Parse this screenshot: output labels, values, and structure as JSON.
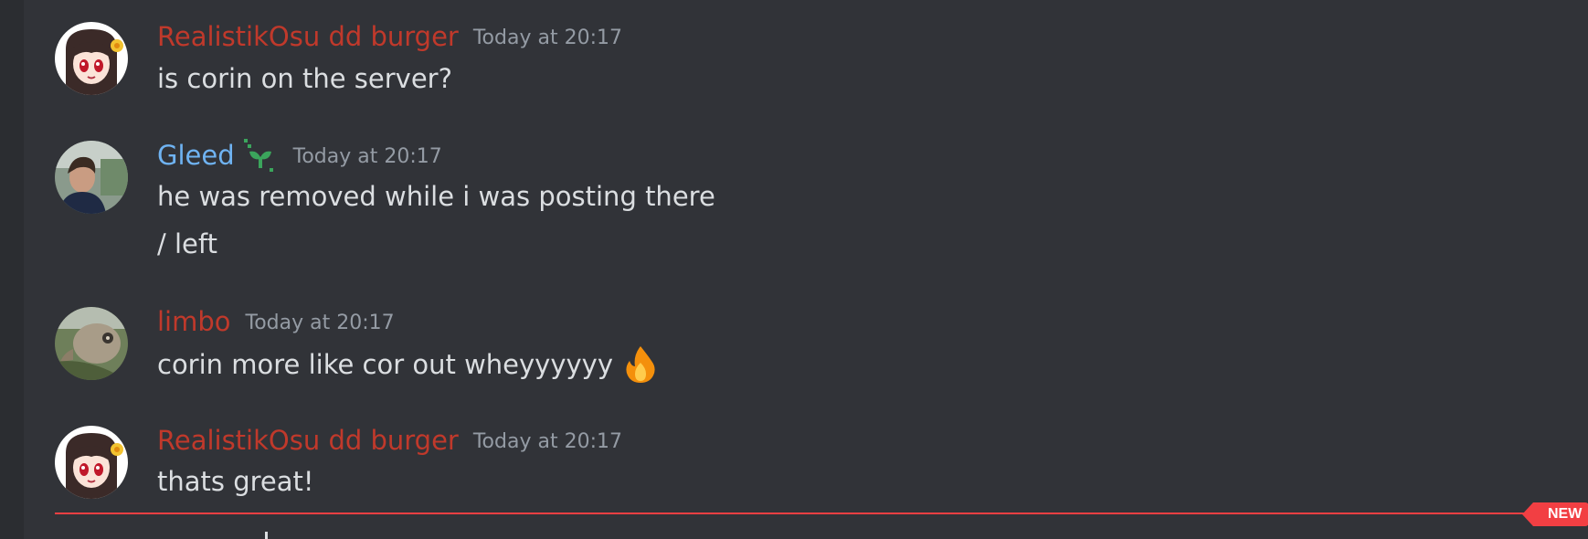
{
  "colors": {
    "background": "#313338",
    "text": "#dbdee1",
    "timestamp": "#949ba4",
    "author_red": "#c0392b",
    "author_blue": "#6fb3f2",
    "new_divider": "#f23f43"
  },
  "messages": [
    {
      "author": "RealistikOsu dd burger",
      "author_color": "#c0392b",
      "timestamp": "Today at 20:17",
      "lines": [
        "is corin on the server?"
      ],
      "avatar": "anime-girl-avatar"
    },
    {
      "author": "Gleed",
      "author_color": "#6fb3f2",
      "badge_icon": "sprout-badge-icon",
      "timestamp": "Today at 20:17",
      "lines": [
        "he was removed while i was posting there",
        "/ left"
      ],
      "avatar": "person-photo-avatar"
    },
    {
      "author": "limbo",
      "author_color": "#c0392b",
      "timestamp": "Today at 20:17",
      "lines": [
        "corin more like cor out wheyyyyyy"
      ],
      "emoji": "fire-emoji-icon",
      "avatar": "ostrich-photo-avatar"
    },
    {
      "author": "RealistikOsu dd burger",
      "author_color": "#c0392b",
      "timestamp": "Today at 20:17",
      "lines": [
        "thats great!"
      ],
      "avatar": "anime-girl-avatar"
    }
  ],
  "new_divider": {
    "label": "NEW"
  }
}
